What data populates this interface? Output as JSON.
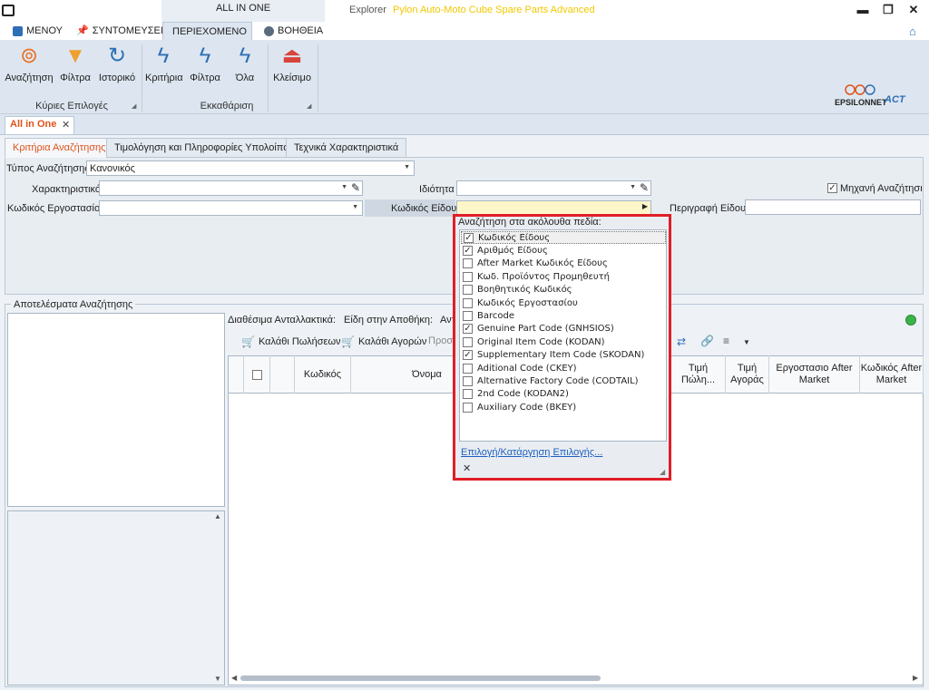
{
  "titlebar": {
    "context_tab": "ALL IN ONE",
    "app": "Explorer",
    "product": "Pylon Auto-Moto Cube Spare Parts Advanced",
    "minimize": "▬",
    "restore": "❐",
    "close": "✕"
  },
  "ribbon_tabs": [
    {
      "label": "ΜΕΝΟΥ",
      "icon": "menu-icon"
    },
    {
      "label": "ΣΥΝΤΟΜΕΥΣΕΙΣ",
      "icon": "pin-icon"
    },
    {
      "label": "ΠΕΡΙΕΧΟΜΕΝΟ",
      "icon": "document-icon"
    },
    {
      "label": "ΒΟΗΘΕΙΑ",
      "icon": "help-icon"
    }
  ],
  "ribbon": {
    "groups": [
      {
        "label": "Κύριες Επιλογές",
        "buttons": [
          "Αναζήτηση",
          "Φίλτρα",
          "Ιστορικό"
        ]
      },
      {
        "label": "Εκκαθάριση",
        "buttons": [
          "Κριτήρια",
          "Φίλτρα",
          "Όλα"
        ]
      },
      {
        "label": "",
        "buttons": [
          "Κλείσιμο"
        ]
      }
    ],
    "brand": "EPSILONNET",
    "brand2": "ACT"
  },
  "doc_tab": {
    "label": "All in One",
    "close": "✕"
  },
  "sub_tabs": [
    "Κριτήρια Αναζήτησης",
    "Τιμολόγηση και Πληροφορίες Υπολοίπου",
    "Τεχνικά Χαρακτηριστικά"
  ],
  "criteria": {
    "search_type_label": "Τύπος Αναζήτησης",
    "search_type_value": "Κανονικός",
    "characteristic_label": "Χαρακτηριστικό",
    "property_label": "Ιδιότητα",
    "engine_label": "Μηχανή Αναζήτησης",
    "engine_checked": true,
    "factory_code_label": "Κωδικός Εργοστασίου",
    "item_code_label": "Κωδικός Είδους",
    "item_desc_label": "Περιγραφή Είδους"
  },
  "results": {
    "title": "Αποτελέσματα Αναζήτησης",
    "available_label": "Διαθέσιμα Ανταλλακτικά:",
    "in_stock_label": "Είδη στην Αποθήκη:",
    "truncated_label": "Αντ",
    "sales_cart": "Καλάθι Πωλήσεων",
    "purchase_cart": "Καλάθι Αγορών",
    "truncated_btn": "Προσθ",
    "columns": [
      "Κωδικός",
      "Όνομα",
      "Τιμή Πώλη...",
      "Τιμή Αγοράς",
      "Εργοστασιο After Market",
      "Κωδικός After Market"
    ]
  },
  "popup": {
    "title": "Αναζήτηση στα ακόλουθα πεδία:",
    "items": [
      {
        "label": "Κωδικός Είδους",
        "checked": true
      },
      {
        "label": "Αριθμός Είδους",
        "checked": true
      },
      {
        "label": "After Market Κωδικός Είδους",
        "checked": false
      },
      {
        "label": "Κωδ. Προϊόντος Προμηθευτή",
        "checked": false
      },
      {
        "label": "Βοηθητικός Κωδικός",
        "checked": false
      },
      {
        "label": "Κωδικός Εργοστασίου",
        "checked": false
      },
      {
        "label": "Barcode",
        "checked": false
      },
      {
        "label": "Genuine Part Code (GNHSIOS)",
        "checked": true
      },
      {
        "label": "Original Item Code (KODAN)",
        "checked": false
      },
      {
        "label": "Supplementary Item Code (SKODAN)",
        "checked": true
      },
      {
        "label": "Aditional Code (CKEY)",
        "checked": false
      },
      {
        "label": "Alternative Factory Code (CODTAIL)",
        "checked": false
      },
      {
        "label": "2nd Code (KODAN2)",
        "checked": false
      },
      {
        "label": "Auxiliary Code (BKEY)",
        "checked": false
      }
    ],
    "link": "Επιλογή/Κατάργηση Επιλογής...",
    "close": "✕"
  },
  "colors": {
    "accent": "#e0521b",
    "popup_border": "#e01e27",
    "status": "#3cb34a"
  }
}
